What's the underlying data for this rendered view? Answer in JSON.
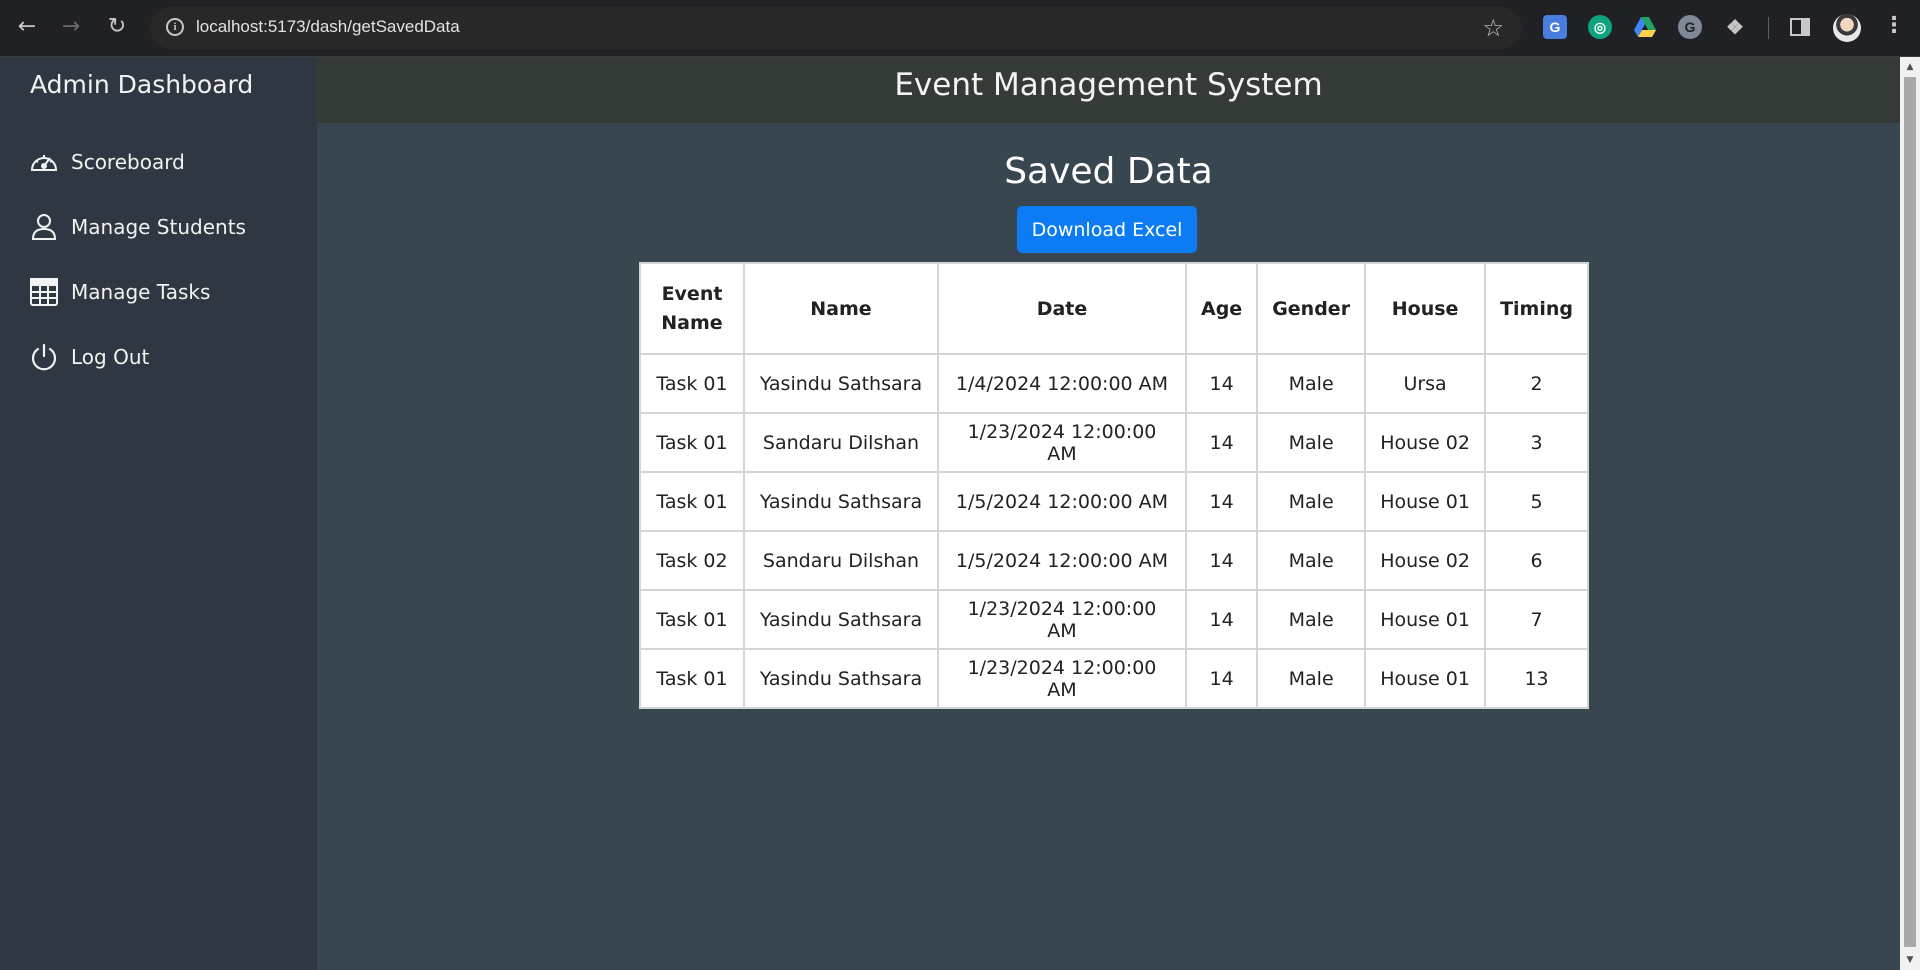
{
  "browser": {
    "url": "localhost:5173/dash/getSavedData"
  },
  "sidebar": {
    "title": "Admin Dashboard",
    "items": [
      {
        "label": "Scoreboard",
        "icon": "speedometer-icon"
      },
      {
        "label": "Manage Students",
        "icon": "person-icon"
      },
      {
        "label": "Manage Tasks",
        "icon": "table-grid-icon"
      },
      {
        "label": "Log Out",
        "icon": "power-icon"
      }
    ]
  },
  "header": {
    "title": "Event Management System"
  },
  "main": {
    "title": "Saved Data",
    "download_label": "Download Excel",
    "table": {
      "columns": [
        "Event Name",
        "Name",
        "Date",
        "Age",
        "Gender",
        "House",
        "Timing"
      ],
      "rows": [
        [
          "Task 01",
          "Yasindu Sathsara",
          "1/4/2024 12:00:00 AM",
          "14",
          "Male",
          "Ursa",
          "2"
        ],
        [
          "Task 01",
          "Sandaru Dilshan",
          "1/23/2024 12:00:00 AM",
          "14",
          "Male",
          "House 02",
          "3"
        ],
        [
          "Task 01",
          "Yasindu Sathsara",
          "1/5/2024 12:00:00 AM",
          "14",
          "Male",
          "House 01",
          "5"
        ],
        [
          "Task 02",
          "Sandaru Dilshan",
          "1/5/2024 12:00:00 AM",
          "14",
          "Male",
          "House 02",
          "6"
        ],
        [
          "Task 01",
          "Yasindu Sathsara",
          "1/23/2024 12:00:00 AM",
          "14",
          "Male",
          "House 01",
          "7"
        ],
        [
          "Task 01",
          "Yasindu Sathsara",
          "1/23/2024 12:00:00 AM",
          "14",
          "Male",
          "House 01",
          "13"
        ]
      ]
    }
  },
  "colors": {
    "sidebar_bg": "#2f3842",
    "header_bg": "#343a36",
    "main_bg": "#37464f",
    "button_bg": "#0d7cf4"
  }
}
